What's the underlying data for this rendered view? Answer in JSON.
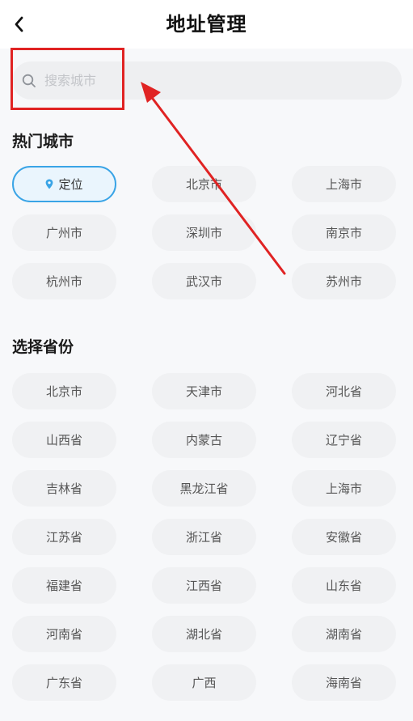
{
  "header": {
    "title": "地址管理",
    "back_icon": "chevron-left-icon"
  },
  "search": {
    "placeholder": "搜索城市",
    "value": "",
    "icon": "search-icon"
  },
  "hot_cities": {
    "title": "热门城市",
    "locate_label": "定位",
    "items": [
      "北京市",
      "上海市",
      "广州市",
      "深圳市",
      "南京市",
      "杭州市",
      "武汉市",
      "苏州市"
    ]
  },
  "provinces": {
    "title": "选择省份",
    "items": [
      "北京市",
      "天津市",
      "河北省",
      "山西省",
      "内蒙古",
      "辽宁省",
      "吉林省",
      "黑龙江省",
      "上海市",
      "江苏省",
      "浙江省",
      "安徽省",
      "福建省",
      "江西省",
      "山东省",
      "河南省",
      "湖北省",
      "湖南省",
      "广东省",
      "广西",
      "海南省"
    ]
  },
  "annotation": {
    "color": "#e02323"
  }
}
